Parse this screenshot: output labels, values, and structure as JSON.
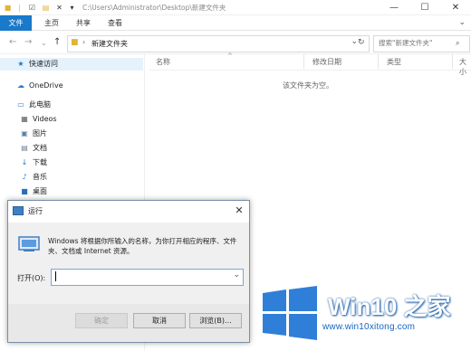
{
  "window": {
    "path_title": "C:\\Users\\Administrator\\Desktop\\新建文件夹",
    "minimize_icon": "minimize-icon",
    "maximize_icon": "maximize-icon",
    "close_icon": "close-icon"
  },
  "ribbon": {
    "tabs": [
      "文件",
      "主页",
      "共享",
      "查看"
    ],
    "file_tab_color": "#1979ca"
  },
  "address": {
    "folder": "新建文件夹",
    "search_placeholder": "搜索\"新建文件夹\""
  },
  "sidebar": {
    "items": [
      {
        "label": "快速访问",
        "icon": "star-icon"
      },
      {
        "label": "OneDrive",
        "icon": "cloud-icon"
      },
      {
        "label": "此电脑",
        "icon": "computer-icon"
      },
      {
        "label": "Videos",
        "icon": "video-icon"
      },
      {
        "label": "图片",
        "icon": "pictures-icon"
      },
      {
        "label": "文档",
        "icon": "documents-icon"
      },
      {
        "label": "下载",
        "icon": "download-icon"
      },
      {
        "label": "音乐",
        "icon": "music-icon"
      },
      {
        "label": "桌面",
        "icon": "desktop-icon"
      }
    ]
  },
  "content": {
    "columns": [
      "名称",
      "修改日期",
      "类型",
      "大小"
    ],
    "empty_message": "该文件夹为空。"
  },
  "run_dialog": {
    "title": "运行",
    "description": "Windows 将根据你所输入的名称，为你打开相应的程序、文件夹、文档或 Internet 资源。",
    "open_label": "打开(O):",
    "input_value": "",
    "ok_label": "确定",
    "cancel_label": "取消",
    "browse_label": "浏览(B)..."
  },
  "watermark": {
    "title": "Win10 之家",
    "url": "www.win10xitong.com",
    "accent": "#1b5da8"
  }
}
